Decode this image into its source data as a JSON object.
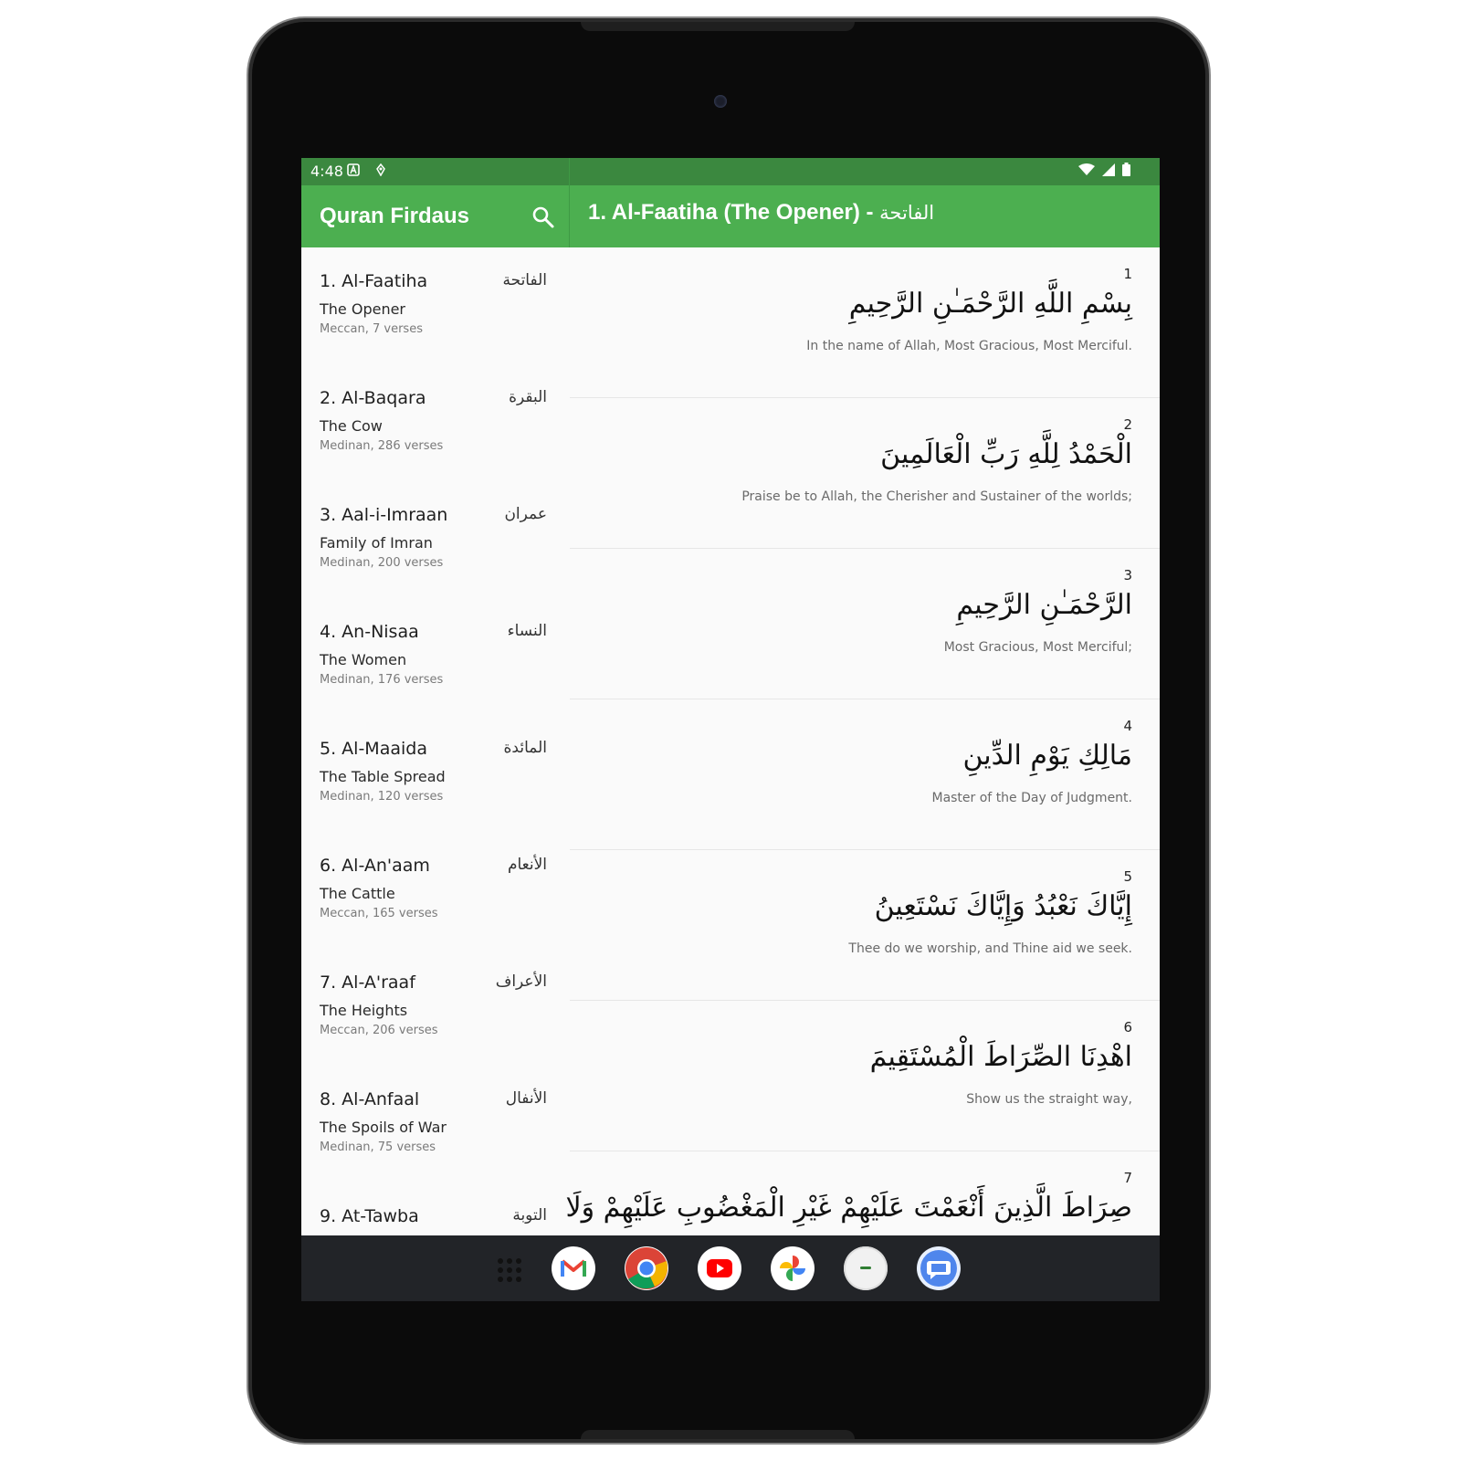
{
  "status_bar": {
    "time": "4:48"
  },
  "app": {
    "title": "Quran Firdaus"
  },
  "chapter_header": {
    "title": "1. Al-Faatiha (The Opener) - ",
    "title_arabic": "الفاتحة"
  },
  "surahs": [
    {
      "name": "1. Al-Faatiha",
      "arabic": "الفاتحة",
      "translation": "The Opener",
      "meta": "Meccan, 7 verses"
    },
    {
      "name": "2. Al-Baqara",
      "arabic": "البقرة",
      "translation": "The Cow",
      "meta": "Medinan, 286 verses"
    },
    {
      "name": "3. Aal-i-Imraan",
      "arabic": "عمران",
      "translation": "Family of Imran",
      "meta": "Medinan, 200 verses"
    },
    {
      "name": "4. An-Nisaa",
      "arabic": "النساء",
      "translation": "The Women",
      "meta": "Medinan, 176 verses"
    },
    {
      "name": "5. Al-Maaida",
      "arabic": "المائدة",
      "translation": "The Table Spread",
      "meta": "Medinan, 120 verses"
    },
    {
      "name": "6. Al-An'aam",
      "arabic": "الأنعام",
      "translation": "The Cattle",
      "meta": "Meccan, 165 verses"
    },
    {
      "name": "7. Al-A'raaf",
      "arabic": "الأعراف",
      "translation": "The Heights",
      "meta": "Meccan, 206 verses"
    },
    {
      "name": "8. Al-Anfaal",
      "arabic": "الأنفال",
      "translation": "The Spoils of War",
      "meta": "Medinan, 75 verses"
    },
    {
      "name": "9. At-Tawba",
      "arabic": "التوبة",
      "translation": "",
      "meta": ""
    }
  ],
  "verses": [
    {
      "number": "1",
      "arabic": "بِسْمِ اللَّهِ الرَّحْمَـٰنِ الرَّحِيمِ",
      "translation": "In the name of Allah, Most Gracious, Most Merciful."
    },
    {
      "number": "2",
      "arabic": "الْحَمْدُ لِلَّهِ رَبِّ الْعَالَمِينَ",
      "translation": "Praise be to Allah, the Cherisher and Sustainer of the worlds;"
    },
    {
      "number": "3",
      "arabic": "الرَّحْمَـٰنِ الرَّحِيمِ",
      "translation": "Most Gracious, Most Merciful;"
    },
    {
      "number": "4",
      "arabic": "مَالِكِ يَوْمِ الدِّينِ",
      "translation": "Master of the Day of Judgment."
    },
    {
      "number": "5",
      "arabic": "إِيَّاكَ نَعْبُدُ وَإِيَّاكَ نَسْتَعِينُ",
      "translation": "Thee do we worship, and Thine aid we seek."
    },
    {
      "number": "6",
      "arabic": "اهْدِنَا الصِّرَاطَ الْمُسْتَقِيمَ",
      "translation": "Show us the straight way,"
    },
    {
      "number": "7",
      "arabic": "صِرَاطَ الَّذِينَ أَنْعَمْتَ عَلَيْهِمْ غَيْرِ الْمَغْضُوبِ عَلَيْهِمْ وَلَا",
      "translation": ""
    }
  ],
  "dock": {
    "items": [
      {
        "icon": "gmail-icon"
      },
      {
        "icon": "chrome-icon"
      },
      {
        "icon": "youtube-icon"
      },
      {
        "icon": "photos-icon"
      },
      {
        "icon": "quran-app-icon"
      },
      {
        "icon": "messages-icon"
      }
    ]
  },
  "colors": {
    "primary": "#4caf50",
    "primary_dark": "#3b883f",
    "background": "#fafafa"
  }
}
